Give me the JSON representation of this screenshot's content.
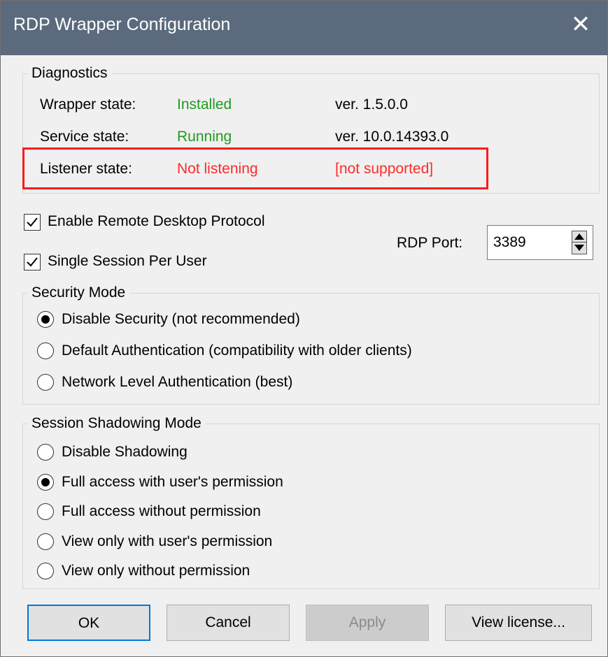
{
  "window": {
    "title": "RDP Wrapper Configuration",
    "close_glyph": "✕"
  },
  "diagnostics": {
    "legend": "Diagnostics",
    "rows": [
      {
        "label": "Wrapper state:",
        "value": "Installed",
        "version": "ver. 1.5.0.0"
      },
      {
        "label": "Service state:",
        "value": "Running",
        "version": "ver. 10.0.14393.0"
      },
      {
        "label": "Listener state:",
        "value": "Not listening",
        "version": "[not supported]"
      }
    ]
  },
  "options": {
    "enable_rdp": {
      "label": "Enable Remote Desktop Protocol",
      "checked": true
    },
    "single_session": {
      "label": "Single Session Per User",
      "checked": true
    },
    "rdp_port_label": "RDP Port:",
    "rdp_port_value": "3389"
  },
  "security_mode": {
    "legend": "Security Mode",
    "options": [
      {
        "label": "Disable Security (not recommended)",
        "selected": true
      },
      {
        "label": "Default Authentication (compatibility with older clients)",
        "selected": false
      },
      {
        "label": "Network Level Authentication (best)",
        "selected": false
      }
    ]
  },
  "shadowing_mode": {
    "legend": "Session Shadowing Mode",
    "options": [
      {
        "label": "Disable Shadowing",
        "selected": false
      },
      {
        "label": "Full access with user's permission",
        "selected": true
      },
      {
        "label": "Full access without permission",
        "selected": false
      },
      {
        "label": "View only with user's permission",
        "selected": false
      },
      {
        "label": "View only without permission",
        "selected": false
      }
    ]
  },
  "buttons": {
    "ok": "OK",
    "cancel": "Cancel",
    "apply": "Apply",
    "view_license": "View license..."
  },
  "colors": {
    "titlebar": "#5b6b7d",
    "status_ok": "#1f9b1f",
    "status_error": "#ff2a2a",
    "highlight": "#ff1a1a",
    "default_button_border": "#0078d7"
  }
}
